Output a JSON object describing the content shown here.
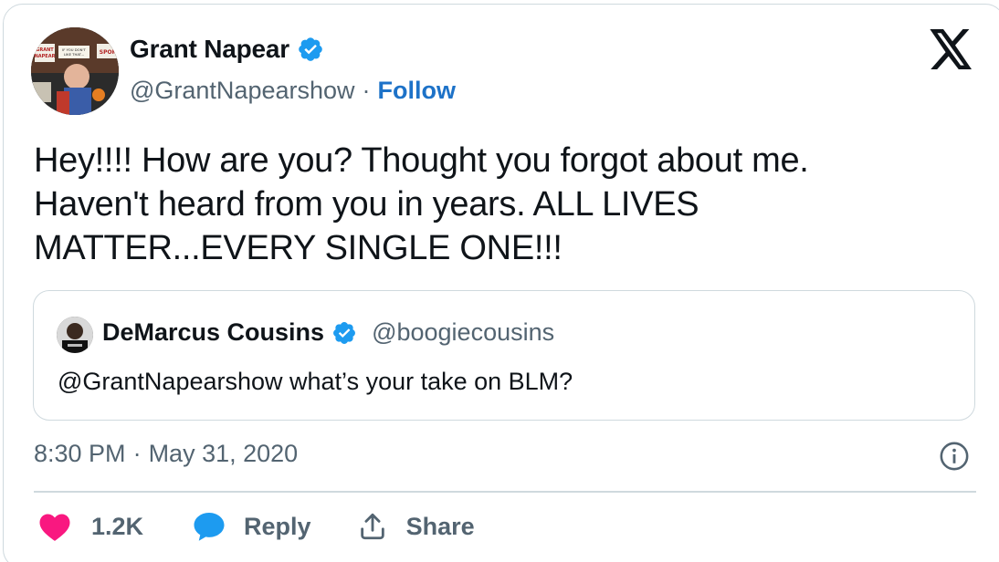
{
  "author": {
    "name": "Grant Napear",
    "handle": "@GrantNapearshow",
    "separator": "·",
    "follow_label": "Follow",
    "avatar_sign_text": "GRANT NAPEAR",
    "avatar_banner_text": "IF YOU DON'T LIKE THAT...",
    "avatar_corner_text": "SPOR"
  },
  "tweet": {
    "text_line1": "Hey!!!! How are you? Thought you forgot about me.",
    "text_line2": "Haven't heard from you in years. ALL LIVES",
    "text_line3": "MATTER...EVERY SINGLE ONE!!!"
  },
  "quoted": {
    "name": "DeMarcus Cousins",
    "handle": "@boogiecousins",
    "text": "@GrantNapearshow what’s your take on BLM?"
  },
  "meta": {
    "time": "8:30 PM",
    "separator": "·",
    "date": "May 31, 2020"
  },
  "actions": {
    "like_count": "1.2K",
    "reply_label": "Reply",
    "share_label": "Share"
  },
  "icons": {
    "verified": "verified-badge-icon",
    "platform": "x-logo-icon",
    "info": "info-icon",
    "like": "heart-icon",
    "reply": "speech-bubble-icon",
    "share": "share-upload-icon"
  },
  "colors": {
    "verified": "#1d9bf0",
    "follow": "#1d72c8",
    "like": "#f91880",
    "reply": "#1d9bf0",
    "secondary_text": "#536471",
    "border": "#cfd9de"
  }
}
